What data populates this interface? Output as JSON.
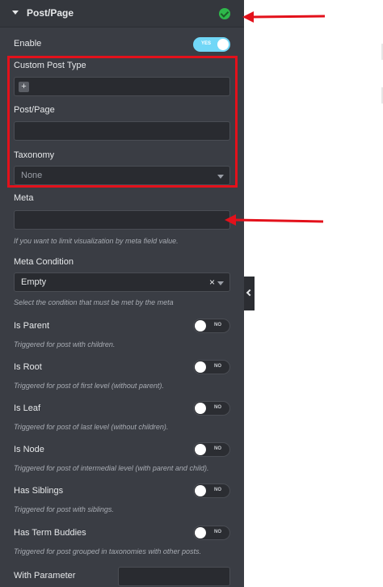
{
  "header": {
    "title": "Post/Page",
    "status_icon": "check-circle-icon"
  },
  "enable": {
    "label": "Enable",
    "toggle": "YES",
    "on": true
  },
  "custom_post_type": {
    "label": "Custom Post Type",
    "add_icon": "+"
  },
  "post_page": {
    "label": "Post/Page",
    "value": ""
  },
  "taxonomy": {
    "label": "Taxonomy",
    "value": "None"
  },
  "meta": {
    "label": "Meta",
    "value": "",
    "help": "If you want to limit visualization by meta field value."
  },
  "meta_condition": {
    "label": "Meta Condition",
    "value": "Empty",
    "clear": "×",
    "help": "Select the condition that must be met by the meta"
  },
  "toggles": [
    {
      "label": "Is Parent",
      "state": "NO",
      "help": "Triggered for post with children."
    },
    {
      "label": "Is Root",
      "state": "NO",
      "help": "Triggered for post of first level (without parent)."
    },
    {
      "label": "Is Leaf",
      "state": "NO",
      "help": "Triggered for post of last level (without children)."
    },
    {
      "label": "Is Node",
      "state": "NO",
      "help": "Triggered for post of intermedial level (with parent and child)."
    },
    {
      "label": "Has Siblings",
      "state": "NO",
      "help": "Triggered for post with siblings."
    },
    {
      "label": "Has Term Buddies",
      "state": "NO",
      "help": "Triggered for post grouped in taxonomies with other posts."
    }
  ],
  "with_parameter": {
    "label": "With Parameter",
    "value": ""
  },
  "colors": {
    "panel": "#3a3d44",
    "accent": "#71d7f7",
    "annotation": "#e3111b",
    "success": "#2eb84b"
  }
}
